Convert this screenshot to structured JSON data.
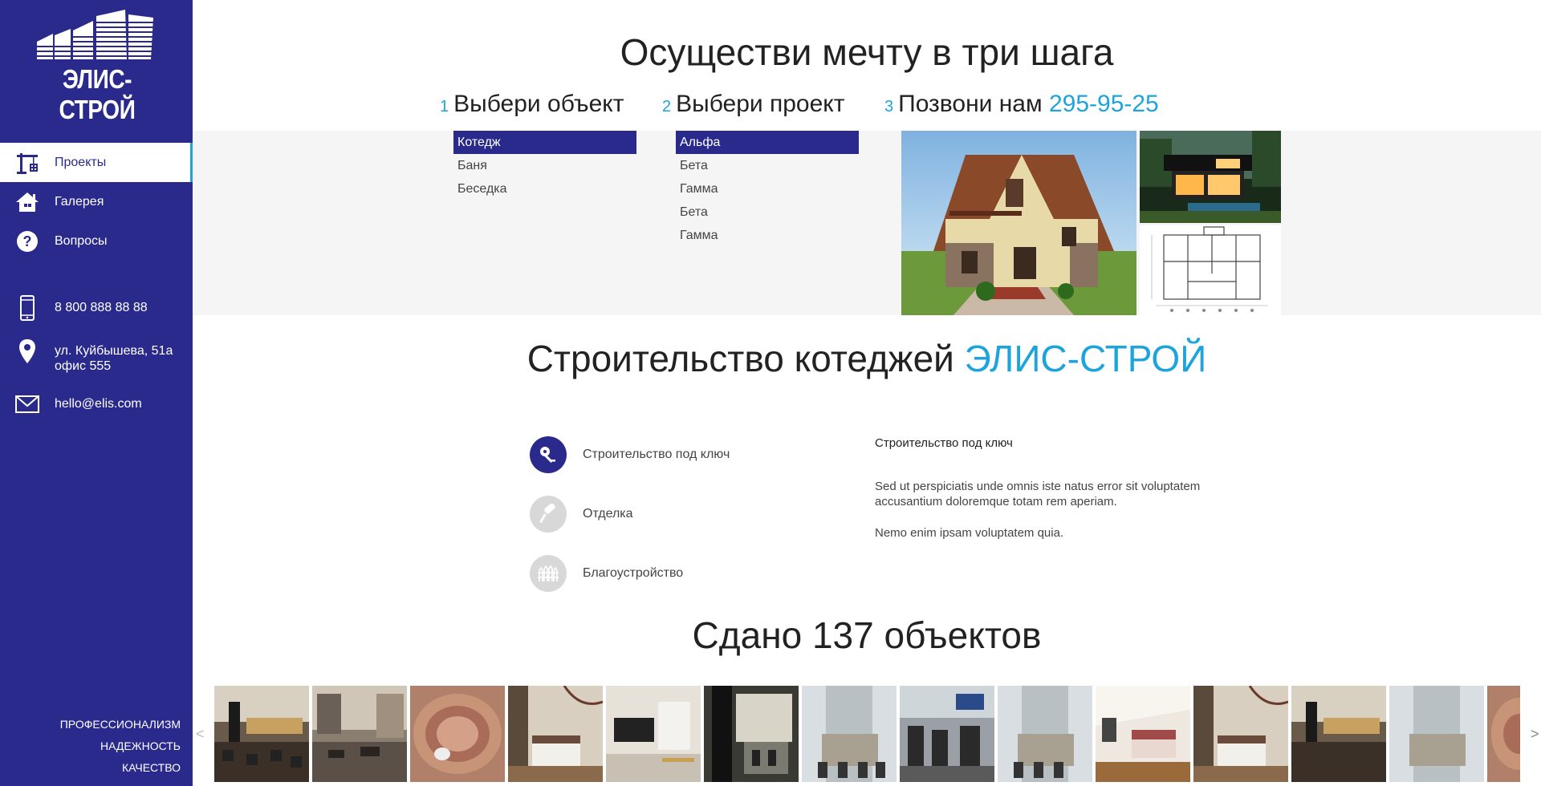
{
  "brand": {
    "name": "ЭЛИС-СТРОЙ",
    "primary_color": "#2a2a8c",
    "accent_color": "#1ea4dc"
  },
  "sidebar": {
    "nav": [
      {
        "label": "Проекты",
        "icon": "crane-icon",
        "active": true
      },
      {
        "label": "Галерея",
        "icon": "house-icon",
        "active": false
      },
      {
        "label": "Вопросы",
        "icon": "question-icon",
        "active": false
      }
    ],
    "contacts": {
      "phone": "8 800 888 88 88",
      "address_line1": "ул. Куйбышева, 51а",
      "address_line2": "офис 555",
      "email": "hello@elis.com"
    },
    "slogans": [
      "ПРОФЕССИОНАЛИЗМ",
      "НАДЕЖНОСТЬ",
      "КАЧЕСТВО"
    ]
  },
  "hero": {
    "title": "Осуществи мечту в три шага",
    "steps": [
      {
        "num": "1",
        "label": "Выбери объект"
      },
      {
        "num": "2",
        "label": "Выбери проект"
      },
      {
        "num": "3",
        "label": "Позвони нам",
        "phone": "295-95-25"
      }
    ],
    "objects": [
      {
        "label": "Котедж",
        "selected": true
      },
      {
        "label": "Баня",
        "selected": false
      },
      {
        "label": "Беседка",
        "selected": false
      }
    ],
    "projects": [
      {
        "label": "Альфа",
        "selected": true
      },
      {
        "label": "Бета",
        "selected": false
      },
      {
        "label": "Гамма",
        "selected": false
      },
      {
        "label": "Бета",
        "selected": false
      },
      {
        "label": "Гамма",
        "selected": false
      }
    ]
  },
  "about": {
    "title": "Строительство котеджей",
    "title_accent": "ЭЛИС-СТРОЙ",
    "services": [
      {
        "label": "Строительство под ключ",
        "icon": "keys-icon",
        "active": true
      },
      {
        "label": "Отделка",
        "icon": "paint-roller-icon",
        "active": false
      },
      {
        "label": "Благоустройство",
        "icon": "fence-icon",
        "active": false
      }
    ],
    "detail": {
      "title": "Строительство под ключ",
      "paragraph1": "Sed ut perspiciatis unde omnis iste natus error sit voluptatem accusantium doloremque totam rem aperiam.",
      "paragraph2": "Nemo enim ipsam voluptatem quia."
    }
  },
  "portfolio": {
    "title": "Сдано 137 объектов",
    "prev_arrow": "<",
    "next_arrow": ">"
  }
}
